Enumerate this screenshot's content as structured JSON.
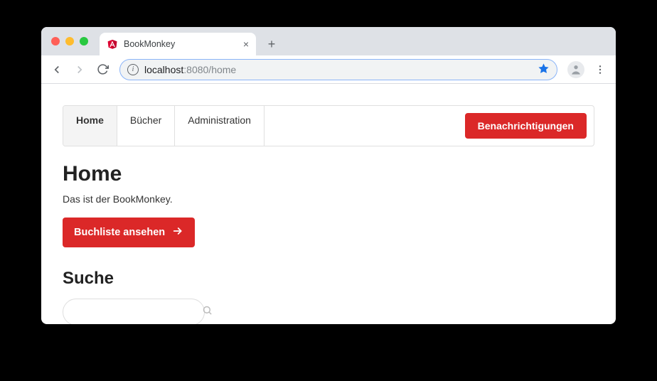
{
  "browser": {
    "tab_title": "BookMonkey",
    "url_host": "localhost",
    "url_port_path": ":8080/home"
  },
  "nav": {
    "items": [
      {
        "label": "Home",
        "active": true
      },
      {
        "label": "Bücher",
        "active": false
      },
      {
        "label": "Administration",
        "active": false
      }
    ],
    "notifications_label": "Benachrichtigungen"
  },
  "home": {
    "heading": "Home",
    "subtitle": "Das ist der BookMonkey.",
    "cta_label": "Buchliste ansehen"
  },
  "search": {
    "heading": "Suche",
    "placeholder": ""
  },
  "colors": {
    "accent_red": "#db2828"
  }
}
